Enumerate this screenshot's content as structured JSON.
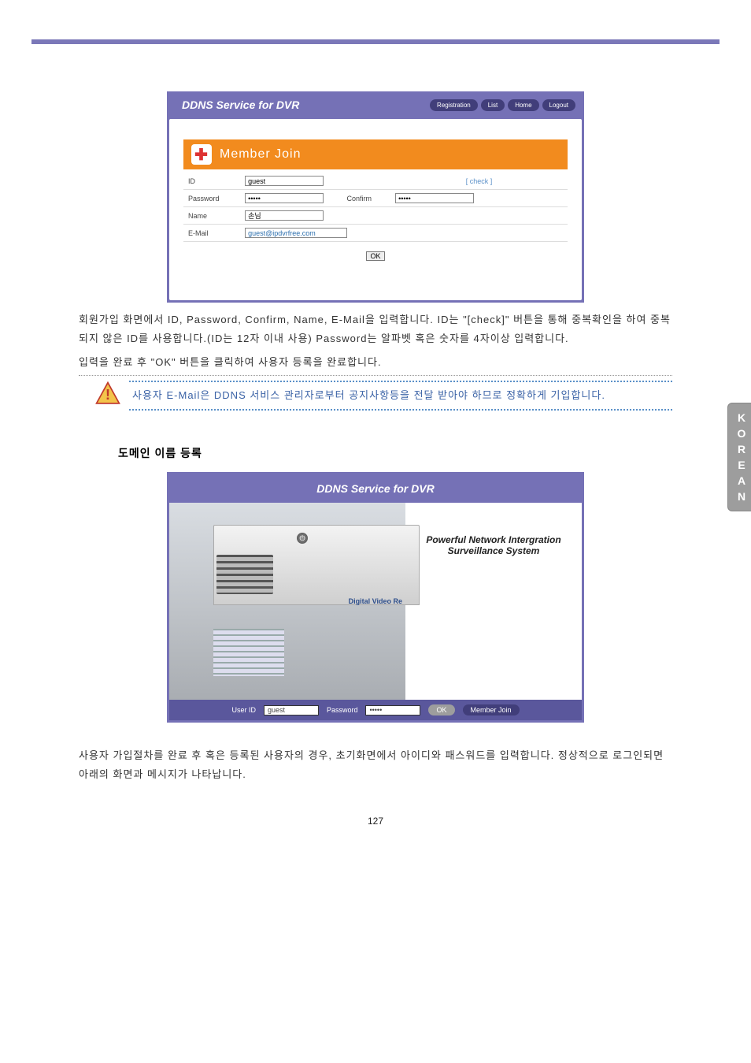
{
  "side_tab": "KOREAN",
  "page_number": "127",
  "screenshot1": {
    "title": "DDNS Service for DVR",
    "nav": {
      "registration": "Registration",
      "list": "List",
      "home": "Home",
      "logout": "Logout"
    },
    "banner": "Member Join",
    "fields": {
      "id_label": "ID",
      "id_value": "guest",
      "check": "[ check ]",
      "pw_label": "Password",
      "pw_value": "•••••",
      "confirm_label": "Confirm",
      "confirm_value": "•••••",
      "name_label": "Name",
      "name_value": "손님",
      "email_label": "E-Mail",
      "email_value": "guest@ipdvrfree.com"
    },
    "ok": "OK"
  },
  "body_text": {
    "p1": "회원가입 화면에서 ID, Password, Confirm, Name, E-Mail을 입력합니다. ID는 \"[check]\" 버튼을 통해 중복확인을 하여 중복되지 않은 ID를 사용합니다.(ID는 12자 이내 사용) Password는 알파벳 혹은 숫자를 4자이상 입력합니다.",
    "p2": "입력을 완료 후 \"OK\" 버튼을 클릭하여 사용자 등록을 완료합니다.",
    "caution": "사용자 E-Mail은 DDNS 서비스 관리자로부터 공지사항등을 전달 받아야 하므로 정확하게 기입합니다.",
    "heading": "도메인 이름 등록",
    "p3": "사용자 가입절차를 완료 후 혹은 등록된 사용자의 경우, 초기화면에서 아이디와 패스워드를 입력합니다. 정상적으로 로그인되면 아래의 화면과 메시지가 나타납니다."
  },
  "screenshot2": {
    "title": "DDNS Service for DVR",
    "tagline1": "Powerful Network Intergration",
    "tagline2": "Surveillance System",
    "dvr_caption": "Digital Video Re",
    "footer": {
      "userid_label": "User ID",
      "userid_value": "guest",
      "pw_label": "Password",
      "pw_value": "•••••",
      "ok": "OK",
      "member_join": "Member Join"
    }
  }
}
